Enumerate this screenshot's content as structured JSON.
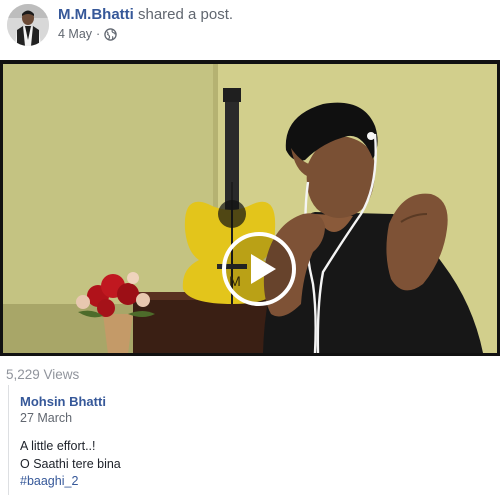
{
  "post": {
    "author": "M.M.Bhatti",
    "action": "shared a post.",
    "date": "4 May",
    "separator": "·",
    "privacy_icon": "globe-icon"
  },
  "video": {
    "play_icon": "play-icon",
    "guitar_badge": "M",
    "views": "5,229 Views"
  },
  "shared_post": {
    "author": "Mohsin Bhatti",
    "date": "27 March",
    "text_lines": [
      "A little effort..!",
      "O Saathi tere bina"
    ],
    "hashtag": "#baaghi_2"
  },
  "colors": {
    "link": "#365899",
    "meta": "#616770",
    "views": "#90949c"
  }
}
